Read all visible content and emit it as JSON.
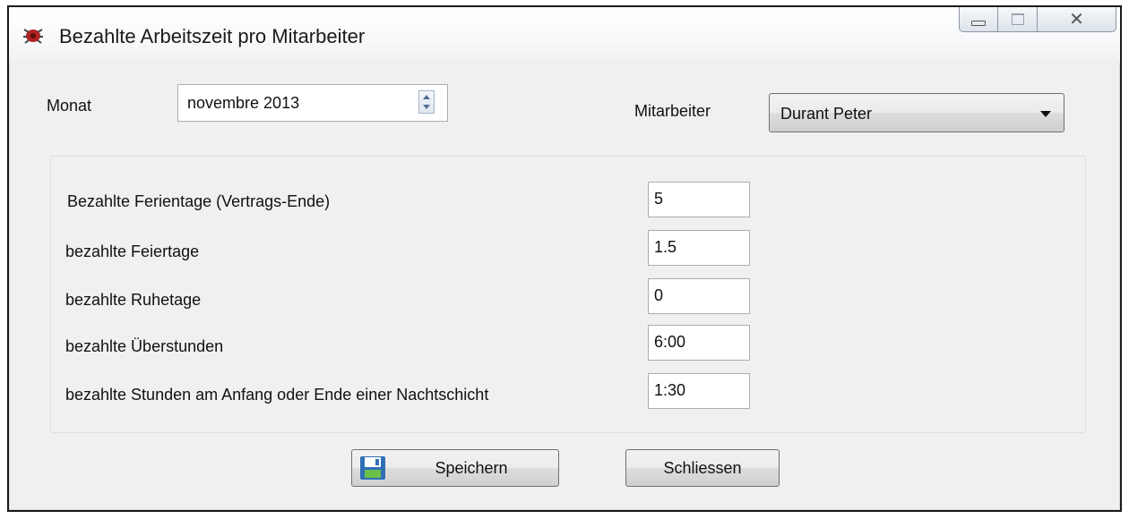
{
  "window": {
    "title": "Bezahlte Arbeitszeit pro Mitarbeiter",
    "icon": "app-bug-icon",
    "caption_buttons": {
      "minimize": "minimize-icon",
      "maximize": "maximize-icon",
      "close": "close-icon"
    },
    "close_glyph": "✕"
  },
  "month": {
    "label": "Monat",
    "value": "novembre 2013"
  },
  "employee": {
    "label": "Mitarbeiter",
    "selected": "Durant Peter"
  },
  "fields": [
    {
      "label": "Bezahlte Ferientage (Vertrags-Ende)",
      "value": "5"
    },
    {
      "label": "bezahlte Feiertage",
      "value": "1.5"
    },
    {
      "label": "bezahlte Ruhetage",
      "value": "0"
    },
    {
      "label": "bezahlte Überstunden",
      "value": "6:00"
    },
    {
      "label": "bezahlte Stunden am Anfang oder Ende einer Nachtschicht",
      "value": "1:30"
    }
  ],
  "buttons": {
    "save_label": "Speichern",
    "save_icon": "floppy-disk-icon",
    "close_label": "Schliessen"
  },
  "colors": {
    "window_border": "#1a1a1a",
    "panel_border": "#d5dfe5",
    "floppy_blue": "#2f6fb6",
    "floppy_green": "#6abf4b"
  }
}
